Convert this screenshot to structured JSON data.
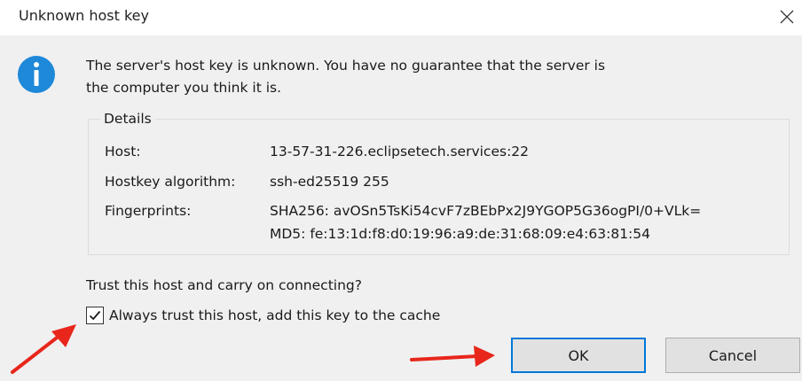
{
  "window": {
    "title": "Unknown host key",
    "close_icon": "close-icon"
  },
  "message": {
    "line1": "The server's host key is unknown. You have no guarantee that the server is",
    "line2": "the computer you think it is.",
    "icon": "info-icon"
  },
  "details": {
    "legend": "Details",
    "host_label": "Host:",
    "host_value": "13-57-31-226.eclipsetech.services:22",
    "algorithm_label": "Hostkey algorithm:",
    "algorithm_value": "ssh-ed25519 255",
    "fingerprints_label": "Fingerprints:",
    "fingerprint_sha256": "SHA256: avOSn5TsKi54cvF7zBEbPx2J9YGOP5G36ogPI/0+VLk=",
    "fingerprint_md5": "MD5: fe:13:1d:f8:d0:19:96:a9:de:31:68:09:e4:63:81:54"
  },
  "prompt": {
    "question": "Trust this host and carry on connecting?",
    "checkbox_label": "Always trust this host, add this key to the cache",
    "checkbox_checked": true
  },
  "buttons": {
    "ok_label": "OK",
    "cancel_label": "Cancel"
  },
  "colors": {
    "accent": "#0078d7",
    "info_icon": "#1e88d9",
    "annotation_arrow": "#e8261c"
  }
}
